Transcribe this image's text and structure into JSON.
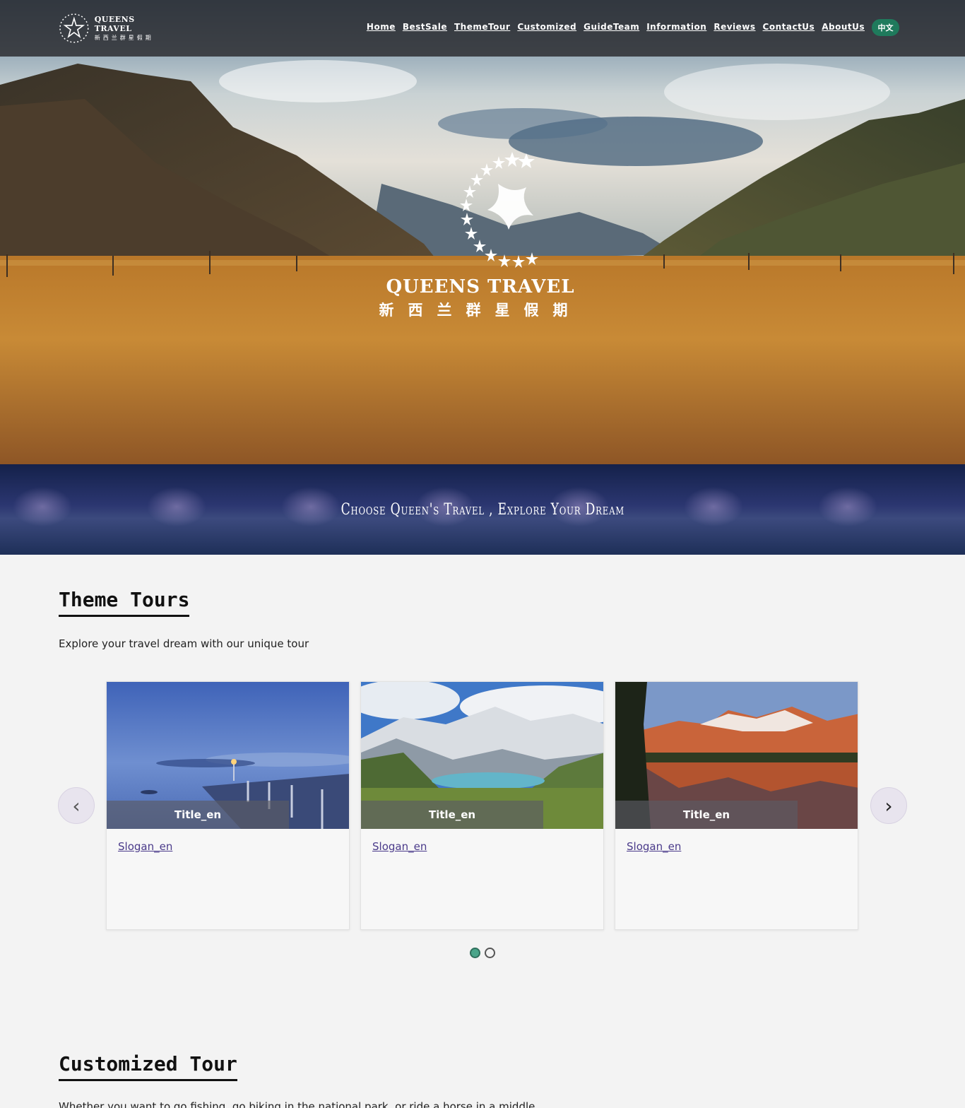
{
  "nav": {
    "logo_en": "Queens Travel",
    "logo_cn": "新西兰群星假期",
    "items": [
      "Home",
      "BestSale",
      "ThemeTour",
      "Customized",
      "GuideTeam",
      "Information",
      "Reviews",
      "ContactUs",
      "AboutUs"
    ],
    "lang_button": "中文"
  },
  "hero": {
    "logo_en": "Queens Travel",
    "logo_cn": "新西兰群星假期"
  },
  "slogan_band": {
    "text": "Choose Queen's Travel , Explore Your Dream"
  },
  "theme_tours": {
    "title": "Theme Tours",
    "description": "Explore your travel dream with our unique tour",
    "cards": [
      {
        "title": "Title_en",
        "slogan": "Slogan_en"
      },
      {
        "title": "Title_en",
        "slogan": "Slogan_en"
      },
      {
        "title": "Title_en",
        "slogan": "Slogan_en"
      }
    ],
    "prev_arrow": "‹",
    "next_arrow": "›",
    "pages": 2,
    "active_page": 1
  },
  "customized_tour": {
    "title": "Customized Tour",
    "description": "Whether you want to go fishing, go biking in the national park, or ride a horse in a middle"
  },
  "colors": {
    "nav_bg": "#28282c",
    "lang_btn": "#1f7a5c",
    "accent_dot": "#4aa58a",
    "slogan_link": "#4a3a8a"
  }
}
